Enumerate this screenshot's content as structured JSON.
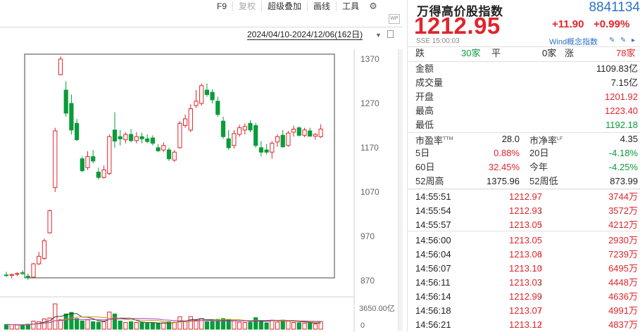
{
  "toolbar": {
    "items": [
      {
        "label": "F9",
        "disabled": false
      },
      {
        "label": "复权",
        "disabled": true
      },
      {
        "label": "超级叠加",
        "disabled": false
      },
      {
        "label": "画线",
        "disabled": false
      },
      {
        "label": "工具",
        "disabled": false
      }
    ],
    "settings_icon": "gear-icon"
  },
  "chart_range": "2024/04/10-2024/12/06(162日)",
  "chart_data": {
    "type": "candlestick",
    "y_ticks": [
      "1370",
      "1270",
      "1170",
      "1070",
      "970",
      "870"
    ],
    "ylim": [
      870,
      1370
    ],
    "volume_ticks": [
      "3650.00亿",
      "0"
    ],
    "up_color": "#e0252b",
    "down_color": "#0a9b3a",
    "candles": [
      {
        "o": 883,
        "h": 890,
        "l": 878,
        "c": 882
      },
      {
        "o": 882,
        "h": 886,
        "l": 875,
        "c": 884
      },
      {
        "o": 885,
        "h": 889,
        "l": 880,
        "c": 886
      },
      {
        "o": 888,
        "h": 893,
        "l": 883,
        "c": 886
      },
      {
        "o": 880,
        "h": 886,
        "l": 872,
        "c": 877
      },
      {
        "o": 878,
        "h": 910,
        "l": 876,
        "c": 908
      },
      {
        "o": 908,
        "h": 935,
        "l": 905,
        "c": 925
      },
      {
        "o": 920,
        "h": 965,
        "l": 917,
        "c": 960
      },
      {
        "o": 978,
        "h": 1030,
        "l": 976,
        "c": 1028
      },
      {
        "o": 1080,
        "h": 1215,
        "l": 1070,
        "c": 1208
      },
      {
        "o": 1335,
        "h": 1376,
        "l": 1333,
        "c": 1370
      },
      {
        "o": 1300,
        "h": 1320,
        "l": 1240,
        "c": 1248
      },
      {
        "o": 1270,
        "h": 1290,
        "l": 1200,
        "c": 1210
      },
      {
        "o": 1225,
        "h": 1235,
        "l": 1185,
        "c": 1188
      },
      {
        "o": 1145,
        "h": 1150,
        "l": 1115,
        "c": 1118
      },
      {
        "o": 1125,
        "h": 1162,
        "l": 1120,
        "c": 1150
      },
      {
        "o": 1150,
        "h": 1165,
        "l": 1135,
        "c": 1140
      },
      {
        "o": 1115,
        "h": 1125,
        "l": 1098,
        "c": 1103
      },
      {
        "o": 1103,
        "h": 1130,
        "l": 1100,
        "c": 1120
      },
      {
        "o": 1112,
        "h": 1200,
        "l": 1108,
        "c": 1195
      },
      {
        "o": 1210,
        "h": 1250,
        "l": 1170,
        "c": 1185
      },
      {
        "o": 1195,
        "h": 1210,
        "l": 1175,
        "c": 1190
      },
      {
        "o": 1188,
        "h": 1205,
        "l": 1180,
        "c": 1200
      },
      {
        "o": 1200,
        "h": 1212,
        "l": 1182,
        "c": 1186
      },
      {
        "o": 1186,
        "h": 1205,
        "l": 1180,
        "c": 1195
      },
      {
        "o": 1195,
        "h": 1204,
        "l": 1180,
        "c": 1190
      },
      {
        "o": 1190,
        "h": 1200,
        "l": 1180,
        "c": 1184
      },
      {
        "o": 1192,
        "h": 1198,
        "l": 1175,
        "c": 1180
      },
      {
        "o": 1170,
        "h": 1178,
        "l": 1160,
        "c": 1163
      },
      {
        "o": 1165,
        "h": 1182,
        "l": 1160,
        "c": 1175
      },
      {
        "o": 1165,
        "h": 1170,
        "l": 1140,
        "c": 1145
      },
      {
        "o": 1142,
        "h": 1165,
        "l": 1138,
        "c": 1160
      },
      {
        "o": 1170,
        "h": 1230,
        "l": 1168,
        "c": 1225
      },
      {
        "o": 1220,
        "h": 1245,
        "l": 1215,
        "c": 1235
      },
      {
        "o": 1210,
        "h": 1268,
        "l": 1205,
        "c": 1258
      },
      {
        "o": 1265,
        "h": 1300,
        "l": 1260,
        "c": 1275
      },
      {
        "o": 1270,
        "h": 1315,
        "l": 1265,
        "c": 1310
      },
      {
        "o": 1300,
        "h": 1315,
        "l": 1285,
        "c": 1290
      },
      {
        "o": 1295,
        "h": 1302,
        "l": 1270,
        "c": 1278
      },
      {
        "o": 1275,
        "h": 1285,
        "l": 1240,
        "c": 1245
      },
      {
        "o": 1230,
        "h": 1240,
        "l": 1190,
        "c": 1195
      },
      {
        "o": 1190,
        "h": 1210,
        "l": 1165,
        "c": 1170
      },
      {
        "o": 1175,
        "h": 1210,
        "l": 1168,
        "c": 1202
      },
      {
        "o": 1200,
        "h": 1222,
        "l": 1195,
        "c": 1215
      },
      {
        "o": 1210,
        "h": 1225,
        "l": 1200,
        "c": 1218
      },
      {
        "o": 1225,
        "h": 1232,
        "l": 1205,
        "c": 1210
      },
      {
        "o": 1220,
        "h": 1226,
        "l": 1170,
        "c": 1175
      },
      {
        "o": 1170,
        "h": 1185,
        "l": 1150,
        "c": 1160
      },
      {
        "o": 1165,
        "h": 1178,
        "l": 1155,
        "c": 1160
      },
      {
        "o": 1160,
        "h": 1185,
        "l": 1145,
        "c": 1180
      },
      {
        "o": 1183,
        "h": 1200,
        "l": 1172,
        "c": 1195
      },
      {
        "o": 1198,
        "h": 1210,
        "l": 1170,
        "c": 1172
      },
      {
        "o": 1175,
        "h": 1208,
        "l": 1172,
        "c": 1203
      },
      {
        "o": 1205,
        "h": 1220,
        "l": 1195,
        "c": 1212
      },
      {
        "o": 1215,
        "h": 1218,
        "l": 1195,
        "c": 1198
      },
      {
        "o": 1198,
        "h": 1215,
        "l": 1194,
        "c": 1210
      },
      {
        "o": 1208,
        "h": 1215,
        "l": 1195,
        "c": 1196
      },
      {
        "o": 1196,
        "h": 1203,
        "l": 1188,
        "c": 1200
      },
      {
        "o": 1195,
        "h": 1223,
        "l": 1192,
        "c": 1212
      }
    ]
  },
  "quote": {
    "name": "万得高价股指数",
    "code": "8841134",
    "price": "1212.95",
    "change": "+11.90",
    "change_pct": "+0.99%",
    "exchange_time": "SSE  15:00:03",
    "concept_link": "Wind概念指数",
    "breadth": {
      "down_label": "跌",
      "down": "30家",
      "flat_label": "平",
      "flat": "0家",
      "up_label": "涨",
      "up": "78家"
    },
    "stats_left": [
      {
        "label": "金额",
        "value": "1109.83亿",
        "color": "normal"
      },
      {
        "label": "成交量",
        "value": "7.15亿",
        "color": "normal"
      },
      {
        "label": "开盘",
        "value": "1201.92",
        "color": "red"
      },
      {
        "label": "最高",
        "value": "1223.40",
        "color": "red"
      },
      {
        "label": "最低",
        "value": "1192.18",
        "color": "green"
      }
    ],
    "pe_label": "市盈率",
    "pe_sup": "TTM",
    "pe_value": "28.0",
    "pb_label": "市净率",
    "pb_sup": "LF",
    "pb_value": "4.35",
    "periods": [
      {
        "l1": "5日",
        "v1": "0.88%",
        "c1": "red",
        "l2": "20日",
        "v2": "-4.18%",
        "c2": "green"
      },
      {
        "l1": "60日",
        "v1": "32.45%",
        "c1": "red",
        "l2": "今年",
        "v2": "-4.25%",
        "c2": "green"
      },
      {
        "l1": "52周高",
        "v1": "1375.96",
        "c1": "normal",
        "l2": "52周低",
        "v2": "873.99",
        "c2": "normal"
      }
    ],
    "ticks": [
      {
        "time": "14:55:51",
        "price": "1212.97",
        "dir": "",
        "vol": "3744万"
      },
      {
        "time": "14:55:54",
        "price": "1212.93",
        "dir": "down",
        "vol": "3572万"
      },
      {
        "time": "14:55:57",
        "price": "1213.05",
        "dir": "up",
        "vol": "4212万"
      },
      {
        "time": "14:56:00",
        "price": "1213.05",
        "dir": "",
        "vol": "2930万"
      },
      {
        "time": "14:56:04",
        "price": "1213.06",
        "dir": "up",
        "vol": "7239万"
      },
      {
        "time": "14:56:07",
        "price": "1213.10",
        "dir": "up",
        "vol": "6495万"
      },
      {
        "time": "14:56:11",
        "price": "1213.03",
        "dir": "down",
        "vol": "4448万"
      },
      {
        "time": "14:56:14",
        "price": "1212.99",
        "dir": "down",
        "vol": "4636万"
      },
      {
        "time": "14:56:18",
        "price": "1213.07",
        "dir": "up",
        "vol": "4991万"
      },
      {
        "time": "14:56:21",
        "price": "1213.12",
        "dir": "up",
        "vol": "4837万"
      }
    ]
  }
}
